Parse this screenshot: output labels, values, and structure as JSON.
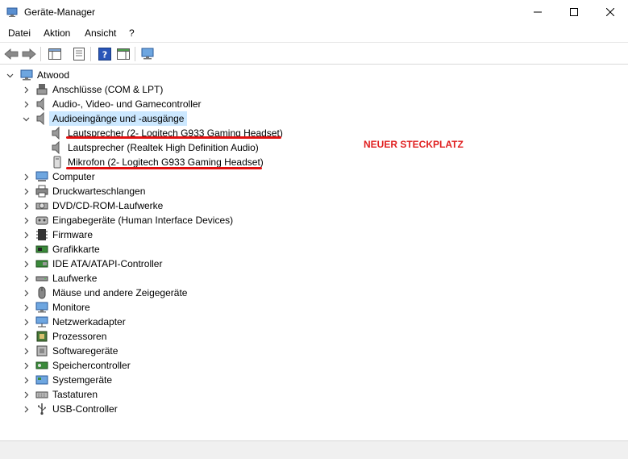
{
  "window": {
    "title": "Geräte-Manager"
  },
  "menu": [
    "Datei",
    "Aktion",
    "Ansicht",
    "?"
  ],
  "tree": {
    "root": "Atwood",
    "categories": [
      "Anschlüsse (COM & LPT)",
      "Audio-, Video- und Gamecontroller",
      "Audioeingänge und -ausgänge",
      "Computer",
      "Druckwarteschlangen",
      "DVD/CD-ROM-Laufwerke",
      "Eingabegeräte (Human Interface Devices)",
      "Firmware",
      "Grafikkarte",
      "IDE ATA/ATAPI-Controller",
      "Laufwerke",
      "Mäuse und andere Zeigegeräte",
      "Monitore",
      "Netzwerkadapter",
      "Prozessoren",
      "Softwaregeräte",
      "Speichercontroller",
      "Systemgeräte",
      "Tastaturen",
      "USB-Controller"
    ],
    "audio_children": [
      "Lautsprecher (2- Logitech G933 Gaming Headset)",
      "Lautsprecher (Realtek High Definition Audio)",
      "Mikrofon (2- Logitech G933 Gaming Headset)"
    ]
  },
  "annotation": "NEUER STECKPLATZ",
  "colors": {
    "selection": "#cce8ff",
    "annotation_red": "#e02020"
  }
}
